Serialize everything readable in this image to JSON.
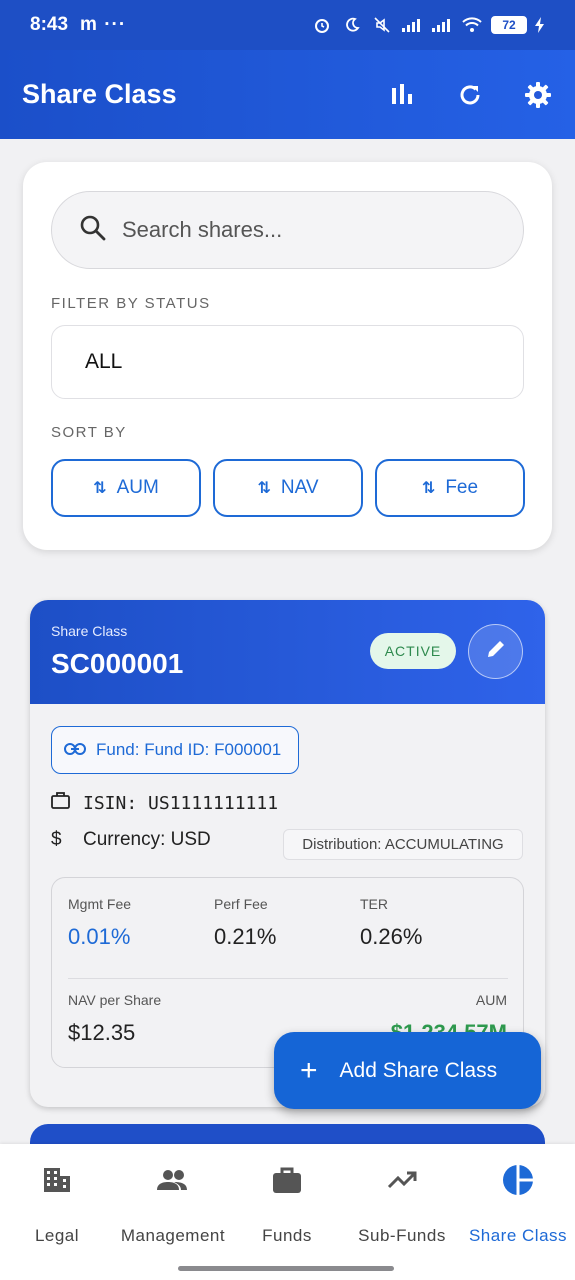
{
  "status_bar": {
    "time": "8:43",
    "extra": "m ···",
    "battery": "72"
  },
  "appbar": {
    "title": "Share Class",
    "icons": [
      "bar-chart-icon",
      "refresh-icon",
      "settings-icon"
    ]
  },
  "filters": {
    "search_placeholder": "Search shares...",
    "status_label": "FILTER BY STATUS",
    "status_value": "ALL",
    "sort_label": "SORT BY",
    "sort_options": [
      "AUM",
      "NAV",
      "Fee"
    ]
  },
  "share_class": {
    "header_label": "Share Class",
    "code": "SC000001",
    "status": "ACTIVE",
    "fund": "Fund: Fund ID: F000001",
    "isin": "ISIN: US1111111111",
    "currency": "Currency: USD",
    "distribution": "Distribution: ACCUMULATING",
    "metrics": {
      "mgmt_fee_label": "Mgmt Fee",
      "mgmt_fee": "0.01%",
      "perf_fee_label": "Perf Fee",
      "perf_fee": "0.21%",
      "ter_label": "TER",
      "ter": "0.26%",
      "nav_label": "NAV per Share",
      "nav": "$12.35",
      "aum_label": "AUM",
      "aum": "$1,234.57M"
    }
  },
  "fab": {
    "label": "Add Share Class"
  },
  "bottom_nav": {
    "items": [
      {
        "label": "Legal",
        "icon": "building-icon"
      },
      {
        "label": "Management",
        "icon": "people-icon"
      },
      {
        "label": "Funds",
        "icon": "briefcase-icon"
      },
      {
        "label": "Sub-Funds",
        "icon": "trending-up-icon"
      },
      {
        "label": "Share Class",
        "icon": "pie-chart-icon"
      }
    ],
    "active": "Share Class"
  },
  "colors": {
    "primary": "#1e4fc5",
    "accent": "#1e6ad6",
    "active_badge_bg": "#e4f7ea",
    "active_badge_text": "#2e8a4e",
    "aum_green": "#2e9a4e"
  }
}
